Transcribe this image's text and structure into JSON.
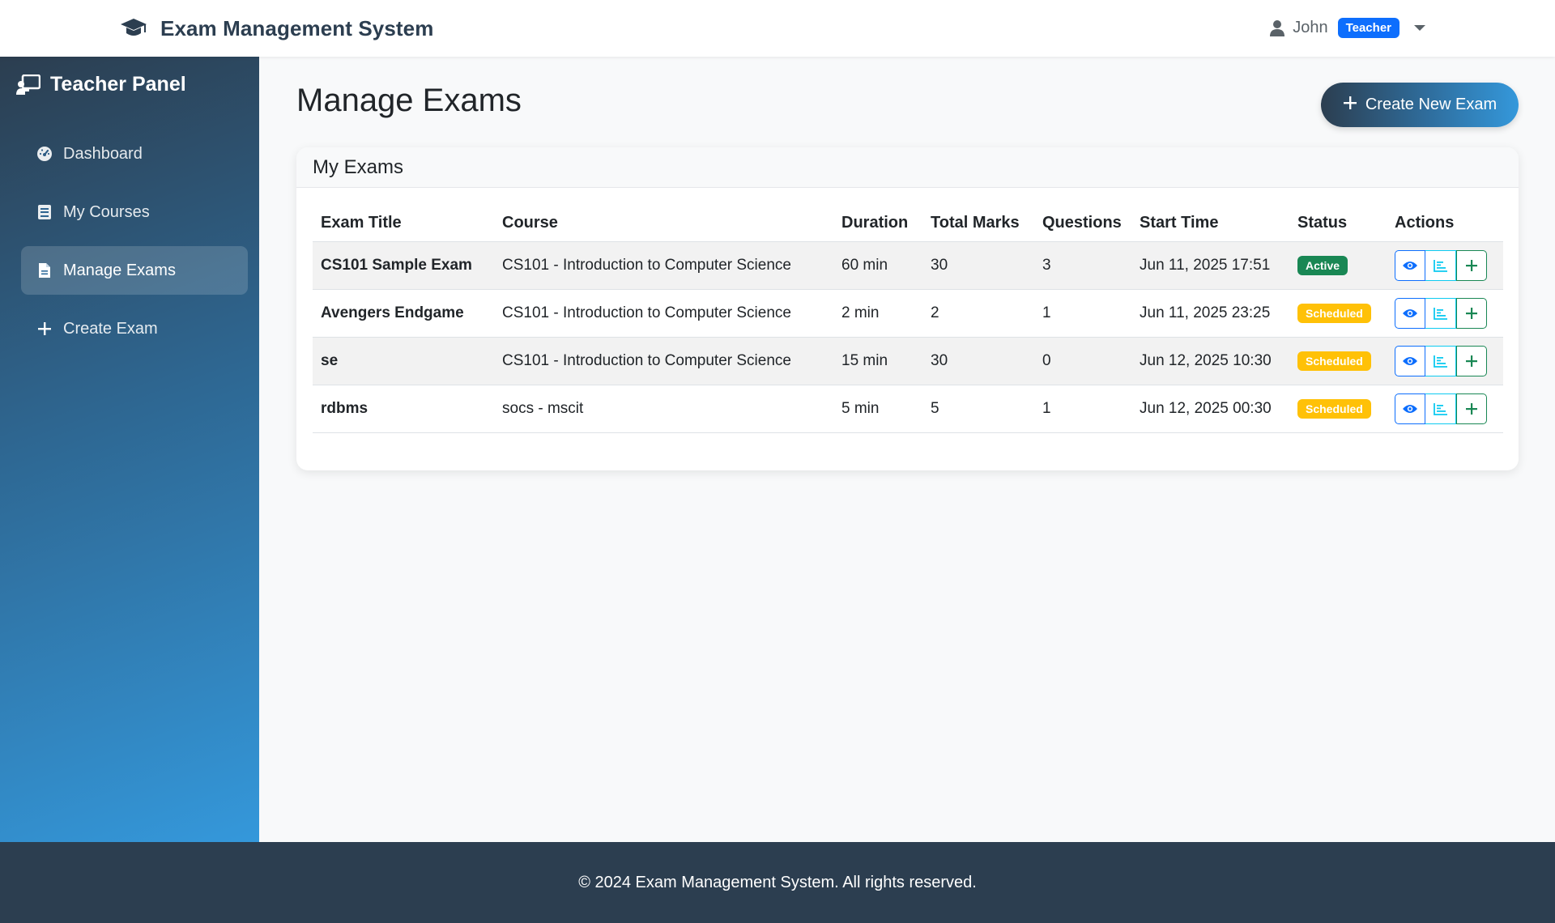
{
  "navbar": {
    "brand": "Exam Management System",
    "user_name": "John",
    "role": "Teacher"
  },
  "sidebar": {
    "title": "Teacher Panel",
    "items": [
      {
        "label": "Dashboard",
        "icon": "gauge-icon"
      },
      {
        "label": "My Courses",
        "icon": "book-icon"
      },
      {
        "label": "Manage Exams",
        "icon": "file-icon",
        "active": true
      },
      {
        "label": "Create Exam",
        "icon": "plus-icon"
      }
    ]
  },
  "main": {
    "page_title": "Manage Exams",
    "create_button": "Create New Exam",
    "card_title": "My Exams",
    "columns": [
      "Exam Title",
      "Course",
      "Duration",
      "Total Marks",
      "Questions",
      "Start Time",
      "Status",
      "Actions"
    ],
    "rows": [
      {
        "title": "CS101 Sample Exam",
        "course": "CS101 - Introduction to Computer Science",
        "duration": "60 min",
        "marks": "30",
        "questions": "3",
        "start": "Jun 11, 2025 17:51",
        "status": "Active"
      },
      {
        "title": "Avengers Endgame",
        "course": "CS101 - Introduction to Computer Science",
        "duration": "2 min",
        "marks": "2",
        "questions": "1",
        "start": "Jun 11, 2025 23:25",
        "status": "Scheduled"
      },
      {
        "title": "se",
        "course": "CS101 - Introduction to Computer Science",
        "duration": "15 min",
        "marks": "30",
        "questions": "0",
        "start": "Jun 12, 2025 10:30",
        "status": "Scheduled"
      },
      {
        "title": "rdbms",
        "course": "socs - mscit",
        "duration": "5 min",
        "marks": "5",
        "questions": "1",
        "start": "Jun 12, 2025 00:30",
        "status": "Scheduled"
      }
    ]
  },
  "footer": {
    "text": "© 2024 Exam Management System. All rights reserved."
  },
  "colors": {
    "primary": "#2c3e50",
    "accent": "#3498db",
    "badge_blue": "#0d6efd",
    "active": "#198754",
    "scheduled": "#ffc107"
  }
}
